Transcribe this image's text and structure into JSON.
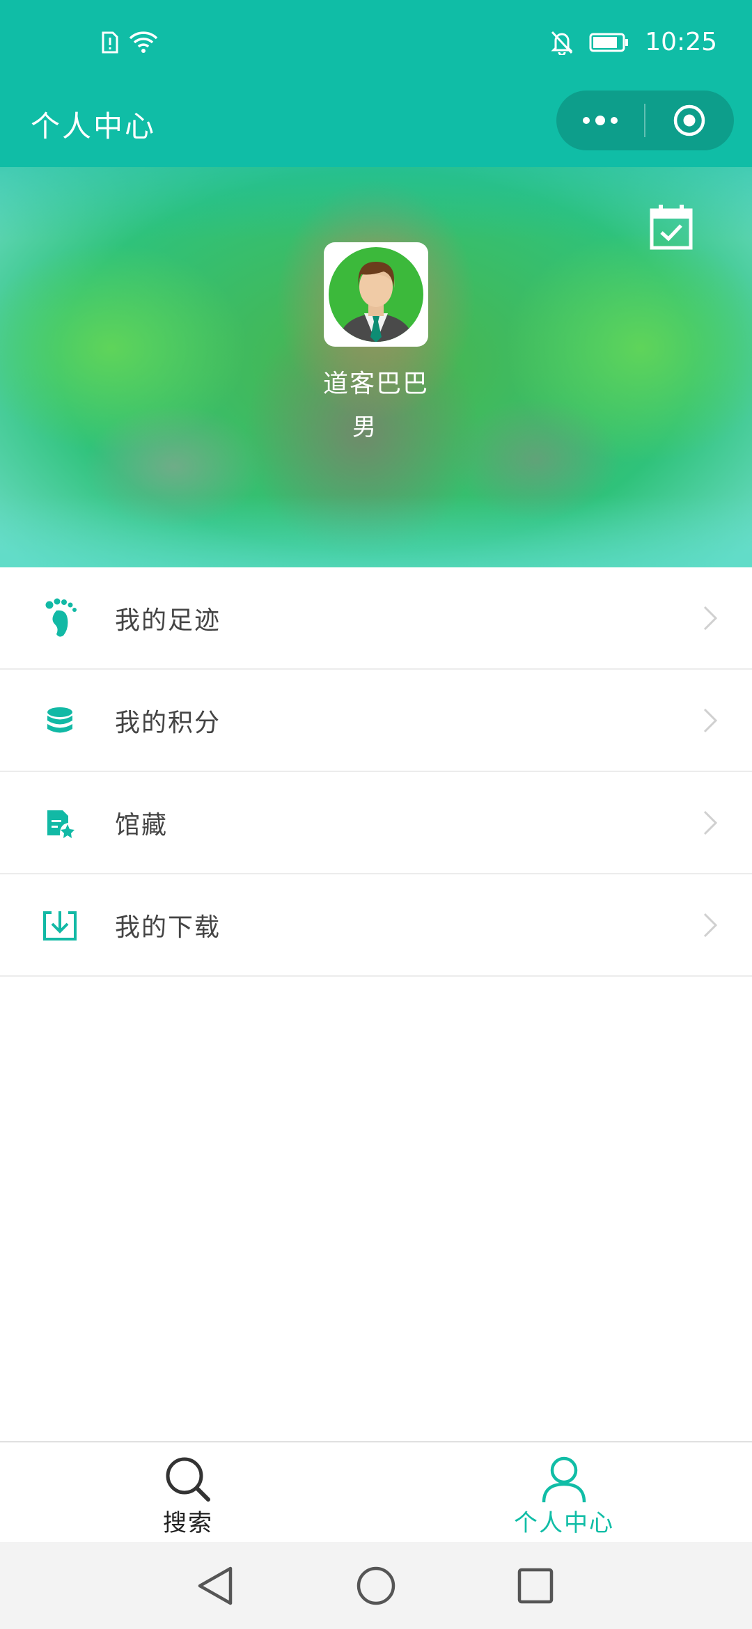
{
  "status_bar": {
    "time": "10:25",
    "icons_left": [
      "sim-alert-icon",
      "wifi-icon"
    ],
    "icons_right": [
      "bell-off-icon",
      "battery-icon"
    ]
  },
  "title_bar": {
    "title": "个人中心",
    "capsule_icons": [
      "more-dots-icon",
      "target-close-icon"
    ],
    "color": "#10bda6"
  },
  "profile": {
    "nickname": "道客巴巴",
    "gender": "男",
    "calendar_icon": "calendar-check-icon"
  },
  "menu": {
    "items": [
      {
        "label": "我的足迹",
        "icon": "footprint-icon"
      },
      {
        "label": "我的积分",
        "icon": "coins-icon"
      },
      {
        "label": "馆藏",
        "icon": "collection-icon"
      },
      {
        "label": "我的下载",
        "icon": "download-icon"
      }
    ]
  },
  "tab_bar": {
    "tabs": [
      {
        "label": "搜索",
        "icon": "search-icon",
        "active": false
      },
      {
        "label": "个人中心",
        "icon": "person-icon",
        "active": true
      }
    ],
    "active_color": "#10bda6"
  },
  "nav_bar": {
    "buttons": [
      "back-triangle-icon",
      "home-circle-icon",
      "recents-square-icon"
    ]
  }
}
